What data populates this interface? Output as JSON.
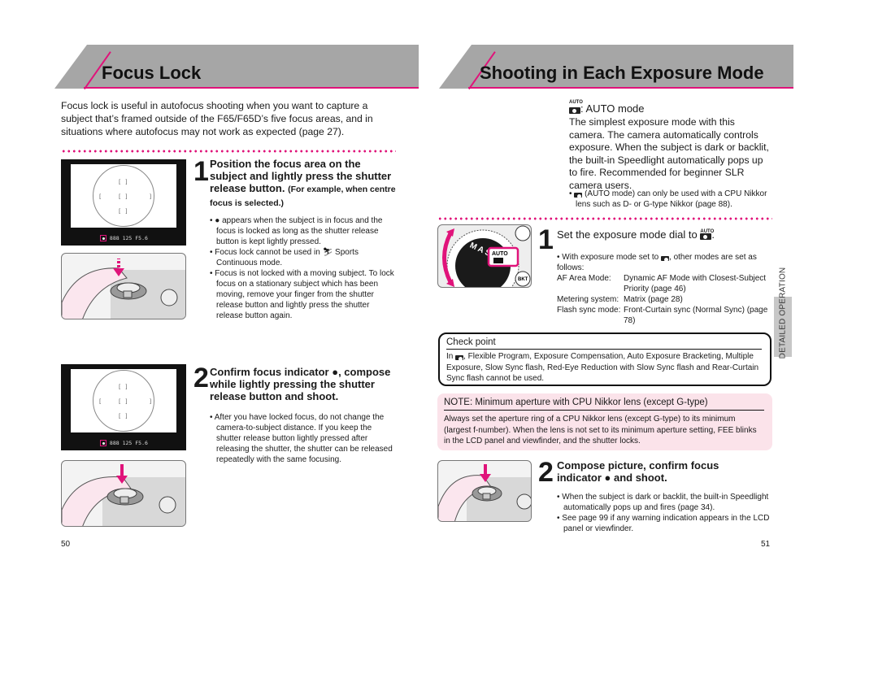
{
  "left_page": {
    "title": "Focus Lock",
    "intro": "Focus lock is useful in autofocus shooting when you want to capture a subject that’s framed outside of the F65/F65D’s five focus areas, and in situations where autofocus may not work as expected (page 27).",
    "viewfinder_readout": {
      "shutter": "125",
      "aperture": "F5.6"
    },
    "step1": {
      "number": "1",
      "title": "Position the focus area on the subject and lightly press the shutter release button.",
      "title_note": "(For example, when centre focus is selected.)",
      "bullets": [
        "● appears when the subject is in focus and the focus is locked as long as the shutter release button is kept lightly pressed.",
        "Focus lock cannot be used in ⛷ Sports Continuous mode.",
        "Focus is not locked with a moving subject. To lock focus on a stationary subject which has been moving, remove your finger from the shutter release button and lightly press the shutter release button again."
      ]
    },
    "step2": {
      "number": "2",
      "title": "Confirm focus indicator ●, compose while lightly pressing the shutter release button and shoot.",
      "bullets": [
        "After you have locked focus, do not change the camera-to-subject distance. If you keep the shutter release button lightly pressed after releasing the shutter, the shutter can be released repeatedly with the same focusing."
      ]
    },
    "page_number": "50"
  },
  "right_page": {
    "title": "Shooting in Each Exposure Mode",
    "auto_mode": {
      "icon_label": "AUTO",
      "heading": ": AUTO mode",
      "body": "The simplest exposure mode with this camera. The camera automatically controls exposure. When the subject is dark or backlit, the built-in Speedlight automatically pops up to fire. Recommended for beginner SLR camera users.",
      "bullet": "(AUTO mode) can only be used with a CPU Nikkor lens such as D- or G-type Nikkor (page 88)."
    },
    "dial_labels": {
      "auto": "AUTO",
      "modes": "M A S P",
      "bkt": "BKT"
    },
    "step1": {
      "number": "1",
      "title": "Set the exposure mode dial to",
      "bullet_intro": "With exposure mode set to",
      "bullet_intro_end": ", other modes are set as follows:",
      "settings": [
        {
          "key": "AF Area Mode:",
          "value": "Dynamic AF Mode with Closest-Subject Priority (page 46)"
        },
        {
          "key": "Metering system:",
          "value": "Matrix (page 28)"
        },
        {
          "key": "Flash sync mode:",
          "value": "Front-Curtain sync (Normal Sync) (page 78)"
        }
      ]
    },
    "checkpoint": {
      "heading": "Check point",
      "body_prefix": "In",
      "body": ", Flexible Program, Exposure Compensation, Auto Exposure Bracketing, Multiple Exposure, Slow Sync flash, Red-Eye Reduction with Slow Sync flash and Rear-Curtain Sync flash cannot be used."
    },
    "note": {
      "heading": "NOTE: Minimum aperture with CPU Nikkor lens (except G-type)",
      "body": "Always set the aperture ring of a CPU Nikkor lens (except G-type) to its minimum (largest f-number). When the lens is not set to its minimum aperture setting, FEE blinks in the LCD panel and viewfinder, and the shutter locks."
    },
    "step2": {
      "number": "2",
      "title": "Compose picture, confirm focus indicator ● and shoot.",
      "bullets": [
        "When the subject is dark or backlit, the built-in Speedlight automatically pops up and fires (page 34).",
        "See page 99 if any warning indication appears in the LCD panel or viewfinder."
      ]
    },
    "side_tab": "DETAILED OPERATION",
    "page_number": "51"
  },
  "colors": {
    "accent": "#e0137a",
    "banner": "#a6a6a6",
    "note_bg": "#fbe3ea",
    "tab": "#c7c7c7"
  }
}
